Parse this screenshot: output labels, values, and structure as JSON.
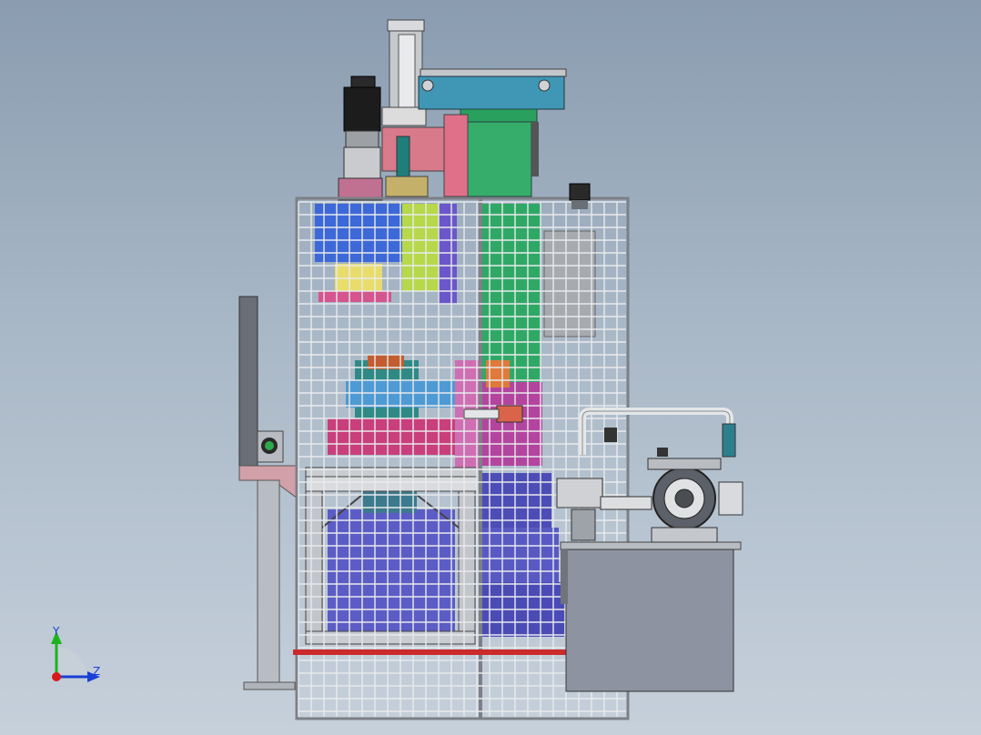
{
  "triad": {
    "y_label": "Y",
    "z_label": "Z",
    "colors": {
      "y": "#1db31d",
      "z": "#1a3fd6",
      "origin": "#d61a1a"
    }
  },
  "palette": {
    "frame": "#c9ccd1",
    "mesh": "#e6e8ea",
    "green": "#2fa866",
    "blue_link": "#3f97b5",
    "pink": "#d76e8f",
    "magenta": "#b3459f",
    "indigo": "#5656c8",
    "tank": "#8d93a0",
    "red_bar": "#cc2a2a",
    "motor": "#1c1c1c"
  }
}
